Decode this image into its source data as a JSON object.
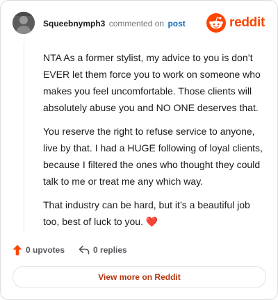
{
  "header": {
    "username": "Squeebnymph3",
    "commented_text": "commented on",
    "post_link": "post",
    "logo_text": "reddit"
  },
  "comment": {
    "paragraphs": [
      "NTA As a former stylist, my advice to you is don’t EVER let them force you to work on someone who makes you feel uncomfortable. Those clients will absolutely abuse you and NO ONE deserves that.",
      "You reserve the right to refuse service to anyone, live by that. I had a HUGE following of loyal clients, because I filtered the ones who thought they could talk to me or treat me any which way.",
      "That industry can be hard, but it’s a beautiful job too, best of luck to you. ❤️"
    ]
  },
  "actions": {
    "upvotes": "0 upvotes",
    "replies": "0 replies"
  },
  "footer": {
    "view_more": "View more on Reddit"
  },
  "colors": {
    "brand": "#ff4500",
    "link": "#0a6ac2",
    "upvote": "#ff4500"
  },
  "icons": {
    "avatar": "user-avatar",
    "logo": "reddit-snoo-icon",
    "upvote": "upvote-arrow-icon",
    "reply": "reply-arrow-icon"
  }
}
